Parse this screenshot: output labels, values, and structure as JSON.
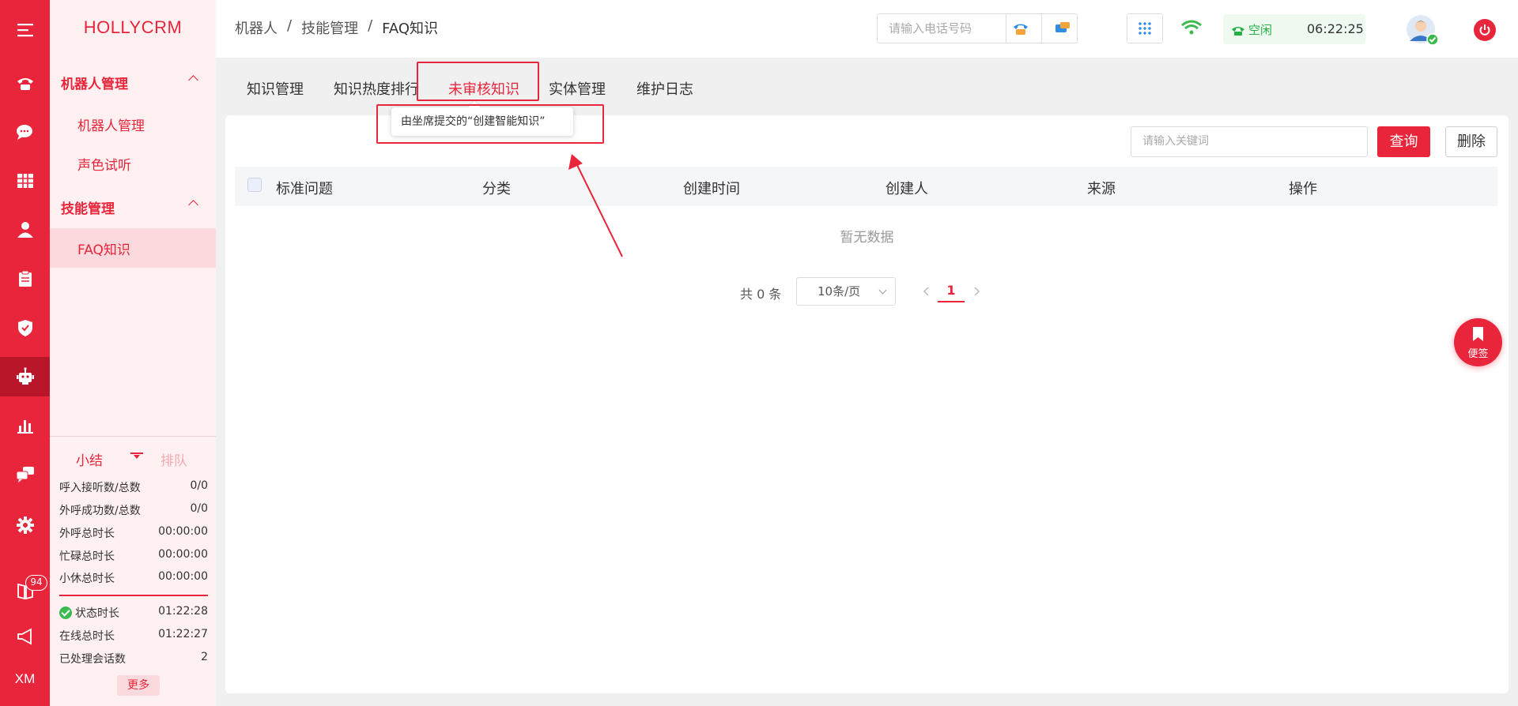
{
  "rail": {
    "items": [
      {
        "name": "menu-icon"
      },
      {
        "name": "phone-icon"
      },
      {
        "name": "chat-icon"
      },
      {
        "name": "grid-icon"
      },
      {
        "name": "user-icon"
      },
      {
        "name": "clipboard-icon"
      },
      {
        "name": "shield-icon"
      },
      {
        "name": "robot-icon",
        "active": true
      },
      {
        "name": "bar-chart-icon"
      },
      {
        "name": "messages-icon"
      },
      {
        "name": "gear-icon"
      },
      {
        "name": "book-icon"
      },
      {
        "name": "megaphone-icon"
      }
    ],
    "badge": "94",
    "footer_text": "XM"
  },
  "sidebar": {
    "brand": "HOLLYCRM",
    "groups": [
      {
        "label": "机器人管理",
        "items": [
          "机器人管理",
          "声色试听"
        ]
      },
      {
        "label": "技能管理",
        "items": [
          "FAQ知识"
        ]
      }
    ],
    "active_item": "FAQ知识"
  },
  "summary": {
    "tab_summary": "小结",
    "tab_queue": "排队",
    "rows": [
      {
        "label": "呼入接听数/总数",
        "value": "0/0"
      },
      {
        "label": "外呼成功数/总数",
        "value": "0/0"
      },
      {
        "label": "外呼总时长",
        "value": "00:00:00"
      },
      {
        "label": "忙碌总时长",
        "value": "00:00:00"
      },
      {
        "label": "小休总时长",
        "value": "00:00:00"
      }
    ],
    "rows2": [
      {
        "label": "状态时长",
        "value": "01:22:28"
      },
      {
        "label": "在线总时长",
        "value": "01:22:27"
      },
      {
        "label": "已处理会话数",
        "value": "2"
      }
    ],
    "more_label": "更多"
  },
  "topbar": {
    "breadcrumb": [
      "机器人",
      "技能管理",
      "FAQ知识"
    ],
    "phone_placeholder": "请输入电话号码",
    "status_label": "空闲",
    "status_time": "06:22:25"
  },
  "tabs": [
    "知识管理",
    "知识热度排行",
    "未审核知识",
    "实体管理",
    "维护日志"
  ],
  "active_tab": "未审核知识",
  "tooltip": "由坐席提交的“创建智能知识”",
  "toolbar": {
    "search_placeholder": "请输入关键词",
    "query_label": "查询",
    "delete_label": "删除"
  },
  "table": {
    "columns": [
      "标准问题",
      "分类",
      "创建时间",
      "创建人",
      "来源",
      "操作"
    ],
    "empty_text": "暂无数据"
  },
  "pager": {
    "total": "共 0 条",
    "page_size": "10条/页",
    "current_page": "1"
  },
  "note_fab": "便签",
  "colors": {
    "accent": "#e8253b",
    "sidebar_bg": "#fff1f2",
    "status_green": "#27b044"
  }
}
